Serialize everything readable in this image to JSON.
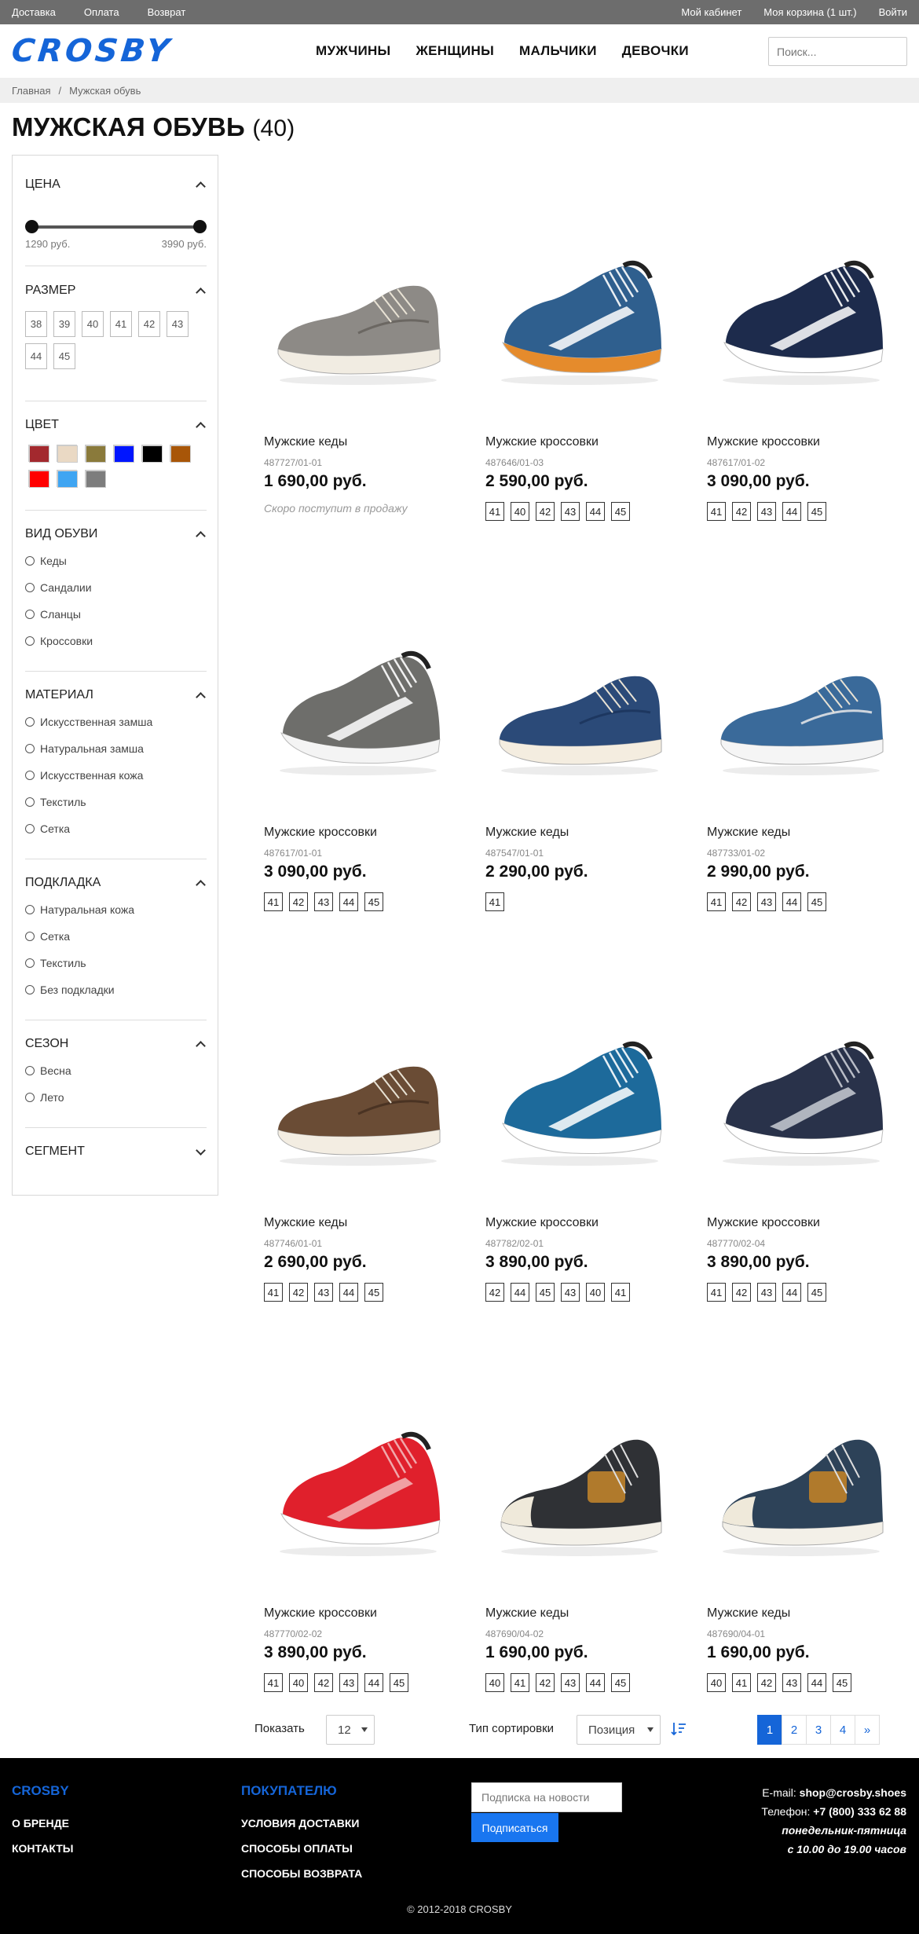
{
  "topbar": {
    "left": [
      "Доставка",
      "Оплата",
      "Возврат"
    ],
    "right": [
      "Мой кабинет",
      "Моя корзина (1 шт.)",
      "Войти"
    ]
  },
  "brand": {
    "logo": "CROSBY",
    "accent": "#1565d8"
  },
  "nav": [
    "МУЖЧИНЫ",
    "ЖЕНЩИНЫ",
    "МАЛЬЧИКИ",
    "ДЕВОЧКИ"
  ],
  "search": {
    "placeholder": "Поиск..."
  },
  "breadcrumbs": [
    "Главная",
    "/",
    "Мужская обувь"
  ],
  "page": {
    "title": "МУЖСКАЯ ОБУВЬ",
    "count": "(40)"
  },
  "filters": {
    "price": {
      "title": "ЦЕНА",
      "min": "1290 руб.",
      "max": "3990 руб."
    },
    "size": {
      "title": "РАЗМЕР",
      "options": [
        "38",
        "39",
        "40",
        "41",
        "42",
        "43",
        "44",
        "45"
      ]
    },
    "color": {
      "title": "ЦВЕТ",
      "swatches": [
        "#a3292e",
        "#ead9c4",
        "#8a7a3b",
        "#0015ff",
        "#000000",
        "#a85608",
        "#ff0000",
        "#3fa5f2",
        "#7d7d7d"
      ]
    },
    "type": {
      "title": "ВИД ОБУВИ",
      "options": [
        "Кеды",
        "Сандалии",
        "Сланцы",
        "Кроссовки"
      ]
    },
    "material": {
      "title": "МАТЕРИАЛ",
      "options": [
        "Искусственная замша",
        "Натуральная замша",
        "Искусственная кожа",
        "Текстиль",
        "Сетка"
      ]
    },
    "lining": {
      "title": "ПОДКЛАДКА",
      "options": [
        "Натуральная кожа",
        "Сетка",
        "Текстиль",
        "Без подкладки"
      ]
    },
    "season": {
      "title": "СЕЗОН",
      "options": [
        "Весна",
        "Лето"
      ]
    },
    "segment": {
      "title": "СЕГМЕНТ"
    }
  },
  "products": [
    {
      "name": "Мужские кеды",
      "sku": "487727/01-01",
      "price": "1 690,00 руб.",
      "note": "Скоро поступит в продажу",
      "sizes": [],
      "style": "canvas",
      "upper": "#8d8a86",
      "trim": "#6b6762",
      "sole": "#f1ece2"
    },
    {
      "name": "Мужские кроссовки",
      "sku": "487646/01-03",
      "price": "2 590,00 руб.",
      "sizes": [
        "41",
        "40",
        "42",
        "43",
        "44",
        "45"
      ],
      "style": "runner",
      "upper": "#2f5f8e",
      "trim": "#ffffff",
      "sole": "#e58b2c"
    },
    {
      "name": "Мужские кроссовки",
      "sku": "487617/01-02",
      "price": "3 090,00 руб.",
      "sizes": [
        "41",
        "42",
        "43",
        "44",
        "45"
      ],
      "style": "runner",
      "upper": "#1d2b4c",
      "trim": "#ffffff",
      "sole": "#ffffff"
    },
    {
      "name": "Мужские кроссовки",
      "sku": "487617/01-01",
      "price": "3 090,00 руб.",
      "sizes": [
        "41",
        "42",
        "43",
        "44",
        "45"
      ],
      "style": "runner",
      "upper": "#6e6e6b",
      "trim": "#ffffff",
      "sole": "#f4f4f4"
    },
    {
      "name": "Мужские кеды",
      "sku": "487547/01-01",
      "price": "2 290,00 руб.",
      "sizes": [
        "41"
      ],
      "style": "canvas",
      "upper": "#2b4a78",
      "trim": "#1d3760",
      "sole": "#f4ede0"
    },
    {
      "name": "Мужские кеды",
      "sku": "487733/01-02",
      "price": "2 990,00 руб.",
      "sizes": [
        "41",
        "42",
        "43",
        "44",
        "45"
      ],
      "style": "canvas",
      "upper": "#3a6a9a",
      "trim": "#cfd6de",
      "sole": "#f5f5f5"
    },
    {
      "name": "Мужские кеды",
      "sku": "487746/01-01",
      "price": "2 690,00 руб.",
      "sizes": [
        "41",
        "42",
        "43",
        "44",
        "45"
      ],
      "style": "canvas",
      "upper": "#6a4c35",
      "trim": "#4a3323",
      "sole": "#f3ede2"
    },
    {
      "name": "Мужские кроссовки",
      "sku": "487782/02-01",
      "price": "3 890,00 руб.",
      "sizes": [
        "42",
        "44",
        "45",
        "43",
        "40",
        "41"
      ],
      "style": "runner",
      "upper": "#1d6a9b",
      "trim": "#ffffff",
      "sole": "#ffffff"
    },
    {
      "name": "Мужские кроссовки",
      "sku": "487770/02-04",
      "price": "3 890,00 руб.",
      "sizes": [
        "41",
        "42",
        "43",
        "44",
        "45"
      ],
      "style": "runner",
      "upper": "#29324a",
      "trim": "#c8ccd4",
      "sole": "#ffffff"
    },
    {
      "name": "Мужские кроссовки",
      "sku": "487770/02-02",
      "price": "3 890,00 руб.",
      "sizes": [
        "41",
        "40",
        "42",
        "43",
        "44",
        "45"
      ],
      "style": "runner",
      "upper": "#e0202c",
      "trim": "#f2b7b9",
      "sole": "#ffffff"
    },
    {
      "name": "Мужские кеды",
      "sku": "487690/04-02",
      "price": "1 690,00 руб.",
      "sizes": [
        "40",
        "41",
        "42",
        "43",
        "44",
        "45"
      ],
      "style": "highcanvas",
      "upper": "#2f3135",
      "trim": "#b07a2c",
      "sole": "#f3f0e8"
    },
    {
      "name": "Мужские кеды",
      "sku": "487690/04-01",
      "price": "1 690,00 руб.",
      "sizes": [
        "40",
        "41",
        "42",
        "43",
        "44",
        "45"
      ],
      "style": "highcanvas",
      "upper": "#2d4258",
      "trim": "#b07a2c",
      "sole": "#f3f0e8"
    }
  ],
  "toolbar": {
    "show_label": "Показать",
    "show_value": "12",
    "sort_label": "Тип сортировки",
    "sort_value": "Позиция",
    "pages": [
      "1",
      "2",
      "3",
      "4",
      "»"
    ],
    "active_page": "1"
  },
  "footer": {
    "col1": {
      "title": "CROSBY",
      "links": [
        "О БРЕНДЕ",
        "КОНТАКТЫ"
      ]
    },
    "col2": {
      "title": "ПОКУПАТЕЛЮ",
      "links": [
        "УСЛОВИЯ ДОСТАВКИ",
        "СПОСОБЫ ОПЛАТЫ",
        "СПОСОБЫ ВОЗВРАТА"
      ]
    },
    "subscribe": {
      "placeholder": "Подписка на новости",
      "button": "Подписаться"
    },
    "contacts": {
      "email_label": "E-mail: ",
      "email": "shop@crosby.shoes",
      "phone_label": "Телефон: ",
      "phone": "+7 (800) 333 62 88",
      "days": "понедельник-пятница",
      "hours": "с 10.00 до 19.00 часов"
    },
    "copyright": "© 2012-2018 CROSBY"
  }
}
